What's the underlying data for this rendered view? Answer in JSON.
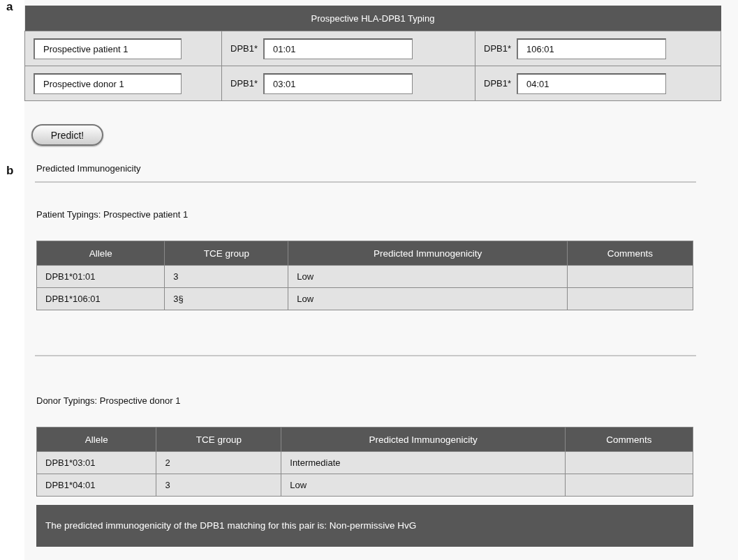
{
  "panel_a": {
    "label": "a",
    "typing": {
      "title": "Prospective HLA-DPB1 Typing",
      "rows": [
        {
          "name": "Prospective patient 1",
          "alleles": [
            {
              "prefix": "DPB1*",
              "value": "01:01"
            },
            {
              "prefix": "DPB1*",
              "value": "106:01"
            }
          ]
        },
        {
          "name": "Prospective donor 1",
          "alleles": [
            {
              "prefix": "DPB1*",
              "value": "03:01"
            },
            {
              "prefix": "DPB1*",
              "value": "04:01"
            }
          ]
        }
      ]
    },
    "predict_button": "Predict!"
  },
  "panel_b": {
    "label": "b",
    "heading": "Predicted Immunogenicity",
    "sections": [
      {
        "title": "Patient Typings: Prospective patient 1",
        "columns": [
          "Allele",
          "TCE group",
          "Predicted Immunogenicity",
          "Comments"
        ],
        "rows": [
          [
            "DPB1*01:01",
            "3",
            "Low"
          ],
          [
            "DPB1*106:01",
            "3§",
            "Low"
          ]
        ]
      },
      {
        "title": "Donor Typings: Prospective donor 1",
        "columns": [
          "Allele",
          "TCE group",
          "Predicted Immunogenicity",
          "Comments"
        ],
        "rows": [
          [
            "DPB1*03:01",
            "2",
            "Intermediate"
          ],
          [
            "DPB1*04:01",
            "3",
            "Low"
          ]
        ]
      }
    ],
    "result": "The predicted immunogenicity of the DPB1 matching for this pair is: Non-permissive HvG"
  }
}
